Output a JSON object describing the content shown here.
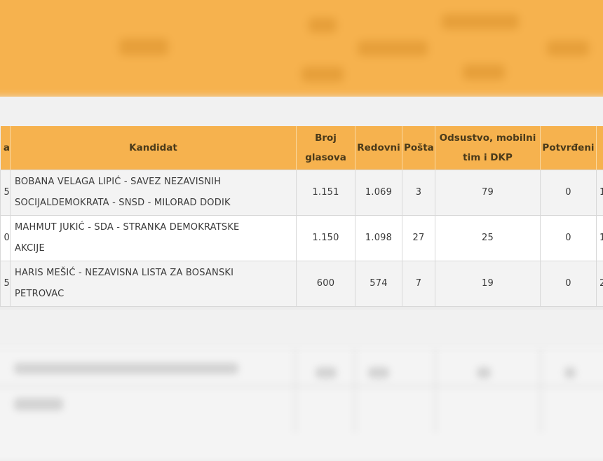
{
  "table": {
    "headers": {
      "left_edge": "a",
      "candidate": "Kandidat",
      "votes_line1": "Broj",
      "votes_line2": "glasova",
      "regular": "Redovni",
      "mail": "Pošta",
      "absent_line1": "Odsustvo, mobilni",
      "absent_line2": "tim i DKP",
      "confirmed": "Potvrđeni"
    },
    "rows": [
      {
        "edge": "5",
        "candidate_line1": "BOBANA VELAGA LIPIĆ - SAVEZ NEZAVISNIH",
        "candidate_line2": "SOCIJALDEMOKRATA - SNSD - MILORAD DODIK",
        "votes": "1.151",
        "regular": "1.069",
        "mail": "3",
        "absent": "79",
        "confirmed": "0",
        "edge_right": "1"
      },
      {
        "edge": "0",
        "candidate_line1": "MAHMUT JUKIĆ - SDA - STRANKA DEMOKRATSKE",
        "candidate_line2": "AKCIJE",
        "votes": "1.150",
        "regular": "1.098",
        "mail": "27",
        "absent": "25",
        "confirmed": "0",
        "edge_right": "1"
      },
      {
        "edge": "5",
        "candidate_line1": "HARIS MEŠIĆ - NEZAVISNA LISTA ZA BOSANSKI",
        "candidate_line2": "PETROVAC",
        "votes": "600",
        "regular": "574",
        "mail": "7",
        "absent": "19",
        "confirmed": "0",
        "edge_right": "2"
      }
    ]
  },
  "colors": {
    "header_bg": "#f6b24e",
    "row_alt_bg": "#f3f3f3",
    "row_bg": "#ffffff",
    "page_bg": "#ececec"
  }
}
